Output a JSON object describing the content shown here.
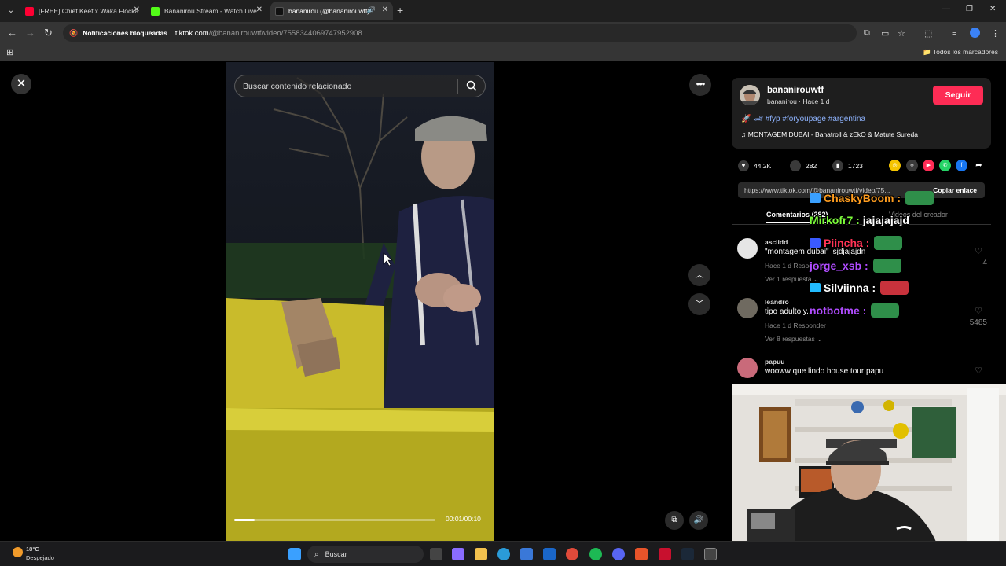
{
  "browser": {
    "tabs": [
      {
        "title": "[FREE] Chief Keef x Waka Flocka",
        "favicon_color": "#ff0033",
        "active": false
      },
      {
        "title": "Bananirou Stream - Watch Live",
        "favicon_color": "#53fc18",
        "active": false
      },
      {
        "title": "bananirou (@bananirouwtf)",
        "favicon_color": "#111111",
        "active": true
      }
    ],
    "new_tab": "+",
    "url_security_label": "Notificaciones bloqueadas",
    "url_host": "tiktok.com",
    "url_path": "/@bananirouwtf/video/7558344069747952908",
    "bookmarks_all_label": "Todos los marcadores"
  },
  "video": {
    "search_placeholder": "Buscar contenido relacionado",
    "time": "00:01/00:10",
    "progress": 0.1
  },
  "post": {
    "username": "bananirouwtf",
    "subline": "bananirou · Hace 1 d",
    "follow_label": "Seguir",
    "hashtags": "🚀 🏎 #fyp #foryoupage #argentina",
    "music": "♫  MONTAGEM DUBAI - Banatroll & zEkO & Matute Sureda",
    "likes": "44.2K",
    "comments": "282",
    "saves": "1723",
    "share_url": "https://www.tiktok.com/@bananirouwtf/video/75...",
    "copy_label": "Copiar enlace",
    "tab_comments": "Comentarios (282)",
    "tab_creator": "Videos del creador"
  },
  "comments": [
    {
      "name": "asciidd",
      "text": "\"montagem dubai\" jsjdjajajdn",
      "meta": "Hace 1 d     Responder",
      "replies": "Ver 1 respuesta ⌄",
      "likes": "4",
      "avatar_color": "#dcdcdc"
    },
    {
      "name": "leandro",
      "text": "tipo adulto y...",
      "meta": "Hace 1 d     Responder",
      "replies": "Ver 8 respuestas ⌄",
      "likes": "5485",
      "avatar_color": "#6f6a60"
    },
    {
      "name": "papuu",
      "text": "wooww que lindo house tour papu",
      "meta": "",
      "replies": "",
      "likes": "",
      "avatar_color": "#c96a7a"
    }
  ],
  "chat": [
    {
      "user": "ChaskyBoom",
      "sep": ":",
      "message": "",
      "color": "#ff9d1f",
      "badge_color": "#3aa0ff",
      "has_emote": true
    },
    {
      "user": "Mirkofr7",
      "sep": ":",
      "message": "jajajajajd",
      "color": "#7cfc3a",
      "badge_color": "",
      "has_emote": false
    },
    {
      "user": "Piincha",
      "sep": ":",
      "message": "",
      "color": "#ff3355",
      "badge_color": "#3a5aff",
      "has_emote": true
    },
    {
      "user": "jorge_xsb",
      "sep": ":",
      "message": "",
      "color": "#b04cff",
      "badge_color": "",
      "has_emote": true
    },
    {
      "user": "Silviinna",
      "sep": ":",
      "message": "",
      "color": "#ffffff",
      "badge_color": "#22bbff",
      "has_emote": true
    },
    {
      "user": "notbotme",
      "sep": ":",
      "message": "",
      "color": "#b04cff",
      "badge_color": "",
      "has_emote": true
    }
  ],
  "taskbar": {
    "temperature": "18°C",
    "condition": "Despejado",
    "search_label": "Buscar"
  }
}
